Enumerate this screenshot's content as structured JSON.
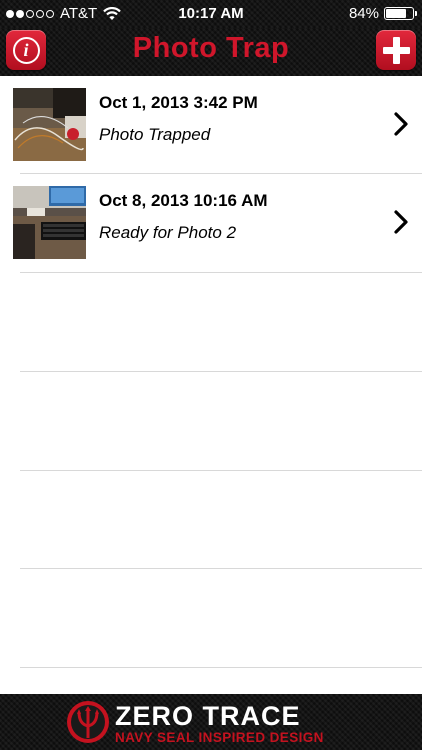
{
  "status_bar": {
    "carrier": "AT&T",
    "time": "10:17 AM",
    "battery_percent_label": "84%",
    "battery_level": 0.84,
    "signal_bars_filled": 2,
    "signal_bars_total": 5,
    "icons": [
      "signal-dots-icon",
      "wifi-icon",
      "battery-icon"
    ]
  },
  "nav": {
    "title": "Photo Trap",
    "info_button_glyph": "i",
    "info_icon": "info-icon",
    "add_icon": "plus-icon",
    "accent_color": "#d0162b"
  },
  "traps": [
    {
      "date": "Oct 1, 2013 3:42 PM",
      "status": "Photo Trapped",
      "thumbnail": "desk-cables-photo",
      "chevron_icon": "chevron-right-icon"
    },
    {
      "date": "Oct 8, 2013 10:16 AM",
      "status": "Ready for Photo 2",
      "thumbnail": "desk-keyboard-photo",
      "chevron_icon": "chevron-right-icon"
    }
  ],
  "footer": {
    "brand_name": "ZERO TRACE",
    "tagline": "NAVY SEAL INSPIRED DESIGN",
    "logo_icon": "trident-logo-icon",
    "brand_color": "#c4121f"
  }
}
